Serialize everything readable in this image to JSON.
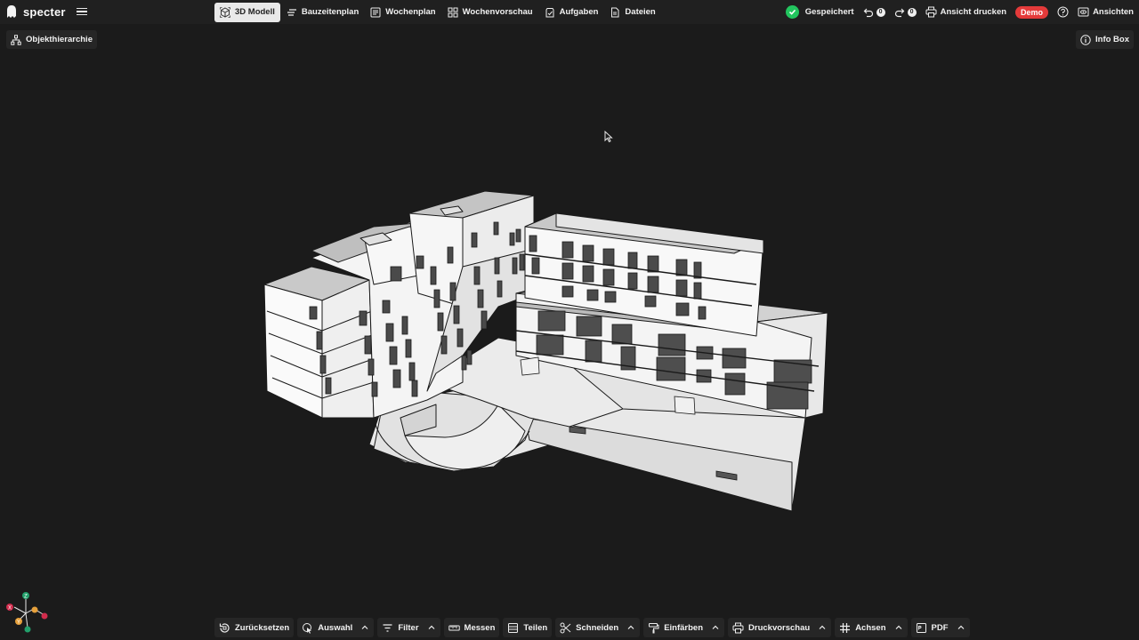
{
  "app": {
    "brand": "specter"
  },
  "nav": [
    {
      "label": "3D Modell",
      "icon": "cube-icon",
      "active": true
    },
    {
      "label": "Bauzeitenplan",
      "icon": "gantt-lines-icon"
    },
    {
      "label": "Wochenplan",
      "icon": "calendar-list-icon"
    },
    {
      "label": "Wochenvorschau",
      "icon": "grid-icon"
    },
    {
      "label": "Aufgaben",
      "icon": "clipboard-check-icon"
    },
    {
      "label": "Dateien",
      "icon": "file-icon"
    }
  ],
  "status": {
    "saved_label": "Gespeichert",
    "undo_count": "0",
    "redo_count": "0",
    "print_label": "Ansicht drucken",
    "demo_label": "Demo",
    "views_label": "Ansichten"
  },
  "left_panel": {
    "hierarchy_label": "Objekthierarchie"
  },
  "right_panel": {
    "info_label": "Info Box"
  },
  "axes": {
    "x": "X",
    "y": "Y",
    "z": "Z"
  },
  "toolbar": {
    "reset": "Zurücksetzen",
    "select": "Auswahl",
    "filter": "Filter",
    "measure": "Messen",
    "split": "Teilen",
    "cut": "Schneiden",
    "color": "Einfärben",
    "print_preview": "Druckvorschau",
    "axes": "Achsen",
    "pdf": "PDF"
  },
  "colors": {
    "background": "#1b1b1b",
    "topbar": "#202020",
    "saved_green": "#22c55e",
    "demo_red": "#e33a3a"
  }
}
